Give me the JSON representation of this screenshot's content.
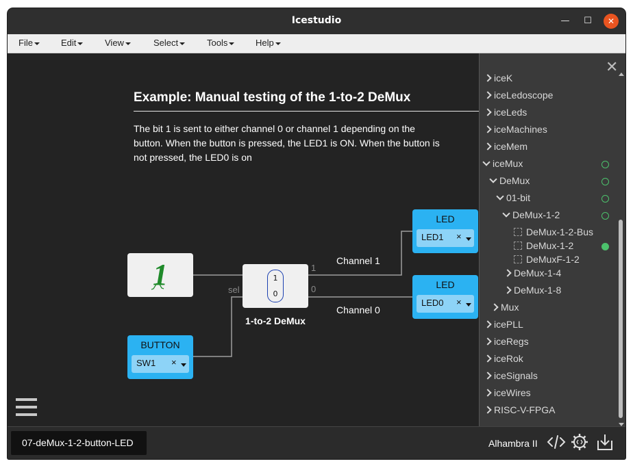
{
  "window": {
    "title": "Icestudio"
  },
  "menubar": {
    "items": [
      "File",
      "Edit",
      "View",
      "Select",
      "Tools",
      "Help"
    ]
  },
  "info": {
    "title": "Example: Manual testing of the 1-to-2 DeMux",
    "text": "The bit 1 is sent to either channel 0 or channel 1 depending on the button. When the button is pressed, the LED1 is ON. When the button is not pressed, the LED0 is on"
  },
  "circuit": {
    "demux": {
      "label": "1-to-2 DeMux",
      "in1": "1",
      "in0": "0",
      "port_sel": "sel",
      "port_1": "1",
      "port_0": "0"
    },
    "channel1": "Channel 1",
    "channel0": "Channel 0",
    "led1": {
      "title": "LED",
      "value": "LED1",
      "clear": "×"
    },
    "led0": {
      "title": "LED",
      "value": "LED0",
      "clear": "×"
    },
    "button": {
      "title": "BUTTON",
      "value": "SW1",
      "clear": "×"
    },
    "constant_icon": "green-one-glyph"
  },
  "tree": {
    "close": "✕",
    "items": [
      {
        "label": "iceK",
        "chevron": "right"
      },
      {
        "label": "iceLedoscope",
        "chevron": "right"
      },
      {
        "label": "iceLeds",
        "chevron": "right"
      },
      {
        "label": "iceMachines",
        "chevron": "right"
      },
      {
        "label": "iceMem",
        "chevron": "right"
      },
      {
        "label": "iceMux",
        "chevron": "down",
        "status": "outline"
      },
      {
        "label": "DeMux",
        "chevron": "down",
        "status": "outline"
      },
      {
        "label": "01-bit",
        "chevron": "down",
        "status": "outline"
      },
      {
        "label": "DeMux-1-2",
        "chevron": "down",
        "status": "outline"
      },
      {
        "label": "DeMux-1-2-Bus",
        "chevron": "chip"
      },
      {
        "label": "DeMux-1-2",
        "chevron": "chip",
        "status": "filled"
      },
      {
        "label": "DeMuxF-1-2",
        "chevron": "chip"
      },
      {
        "label": "DeMux-1-4",
        "chevron": "right"
      },
      {
        "label": "DeMux-1-8",
        "chevron": "right"
      },
      {
        "label": "Mux",
        "chevron": "right"
      },
      {
        "label": "icePLL",
        "chevron": "right"
      },
      {
        "label": "iceRegs",
        "chevron": "right"
      },
      {
        "label": "iceRok",
        "chevron": "right"
      },
      {
        "label": "iceSignals",
        "chevron": "right"
      },
      {
        "label": "iceWires",
        "chevron": "right"
      },
      {
        "label": "RISC-V-FPGA",
        "chevron": "right"
      }
    ]
  },
  "statusbar": {
    "file": "07-deMux-1-2-button-LED",
    "board": "Alhambra II",
    "icons": [
      "code-icon",
      "settings-gear-icon",
      "download-icon"
    ]
  },
  "colors": {
    "io_block": "#2bb2f2",
    "status_green": "#4cc16c",
    "close_button": "#e95420"
  }
}
